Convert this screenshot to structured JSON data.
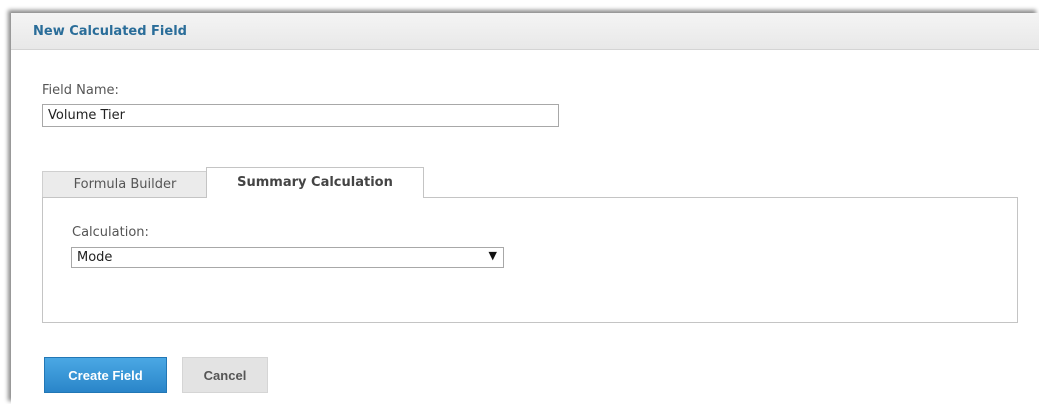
{
  "dialog": {
    "title": "New Calculated Field"
  },
  "field_name": {
    "label": "Field Name:",
    "value": "Volume Tier"
  },
  "tabs": [
    {
      "label": "Formula Builder",
      "active": false
    },
    {
      "label": "Summary Calculation",
      "active": true
    }
  ],
  "summary": {
    "calculation_label": "Calculation:",
    "calculation_value": "Mode",
    "dropdown_arrow": "▼"
  },
  "buttons": {
    "create": "Create Field",
    "cancel": "Cancel"
  },
  "colors": {
    "title": "#2a6d99",
    "primary_button": "#2a85c9",
    "secondary_button": "#e3e3e3"
  }
}
